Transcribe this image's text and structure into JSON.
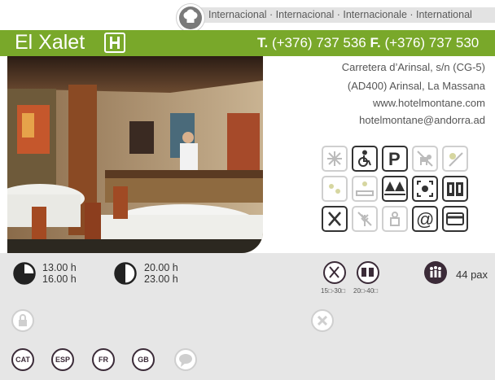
{
  "cuisine": {
    "text": "Internacional · Internacional · Internacionale · International",
    "icon": "chef-hat-icon"
  },
  "header": {
    "name": "El Xalet",
    "logo_icon": "hotel-logo-icon",
    "phone_label": "T.",
    "phone": "(+376) 737 536",
    "fax_label": "F.",
    "fax": "(+376) 737 530",
    "bar_color": "#79a82a"
  },
  "address": {
    "line1": "Carretera d’Arinsal, s/n (CG-5)",
    "line2": "(AD400) Arinsal, La Massana",
    "web": "www.hotelmontane.com",
    "email": "hotelmontane@andorra.ad"
  },
  "amenities": [
    {
      "icon": "snowflake-icon",
      "active": false
    },
    {
      "icon": "wheelchair-icon",
      "active": true
    },
    {
      "icon": "parking-icon",
      "active": true
    },
    {
      "icon": "no-dogs-icon",
      "active": false
    },
    {
      "icon": "sun-icon",
      "active": false
    },
    {
      "icon": "sun-small-icon",
      "active": false
    },
    {
      "icon": "terrace-icon",
      "active": false
    },
    {
      "icon": "trees-icon",
      "active": true
    },
    {
      "icon": "expand-icon",
      "active": true
    },
    {
      "icon": "menu-book-icon",
      "active": true
    },
    {
      "icon": "cutlery-icon",
      "active": true
    },
    {
      "icon": "no-gluten-icon",
      "active": false
    },
    {
      "icon": "chef-icon",
      "active": false
    },
    {
      "icon": "at-icon",
      "active": true
    },
    {
      "icon": "credit-card-icon",
      "active": true
    }
  ],
  "hours": {
    "lunch_start": "13.00 h",
    "lunch_end": "16.00 h",
    "dinner_start": "20.00 h",
    "dinner_end": "23.00 h"
  },
  "prices": {
    "menu_price": "15□-30□",
    "carte_price": "20□-40□"
  },
  "capacity": {
    "text": "44 pax"
  },
  "languages": [
    "CAT",
    "ESP",
    "FR",
    "GB"
  ]
}
